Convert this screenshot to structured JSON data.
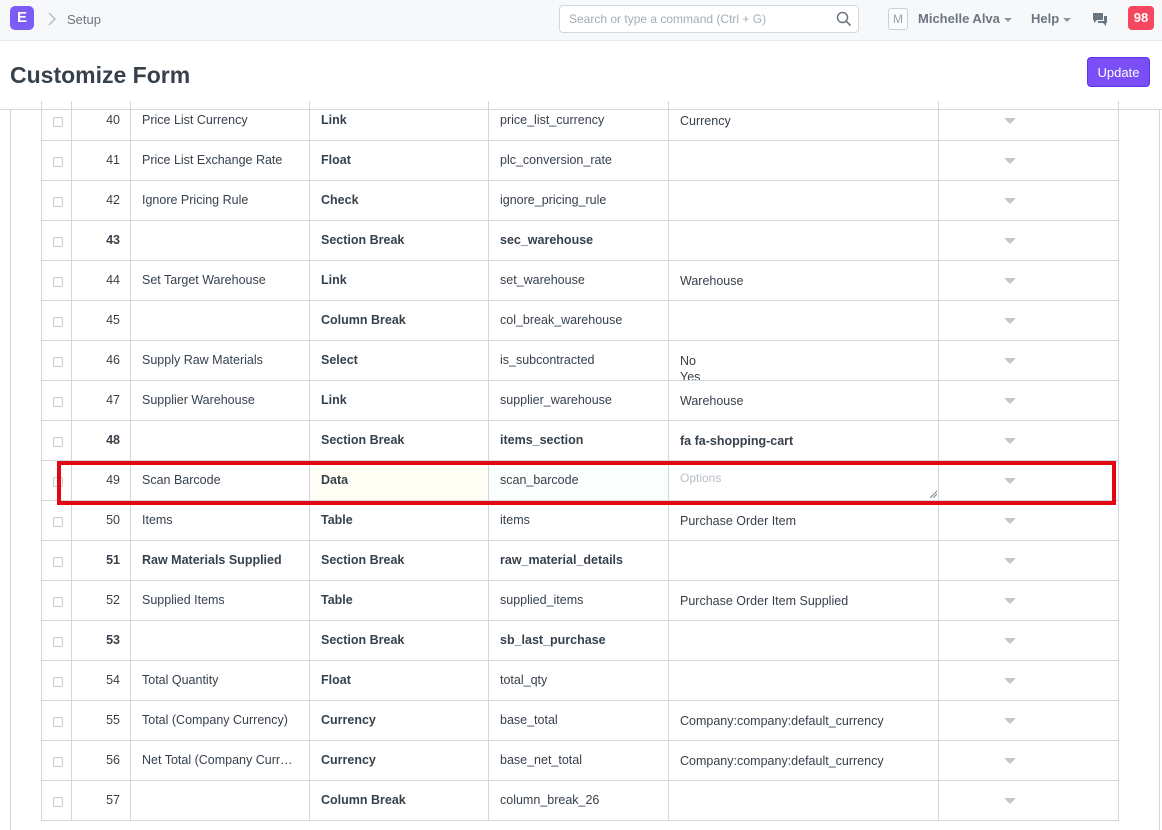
{
  "navbar": {
    "logo_letter": "E",
    "breadcrumb": "Setup",
    "search_placeholder": "Search or type a command (Ctrl + G)",
    "avatar_letter": "M",
    "user_name": "Michelle Alva",
    "help_label": "Help",
    "notification_count": "98"
  },
  "page": {
    "title": "Customize Form",
    "update_label": "Update"
  },
  "grid": {
    "options_placeholder": "Options",
    "rows": [
      {
        "idx": "40",
        "label": "Price List Currency",
        "type": "Link",
        "fieldname": "price_list_currency",
        "options": "Currency"
      },
      {
        "idx": "41",
        "label": "Price List Exchange Rate",
        "type": "Float",
        "fieldname": "plc_conversion_rate",
        "options": ""
      },
      {
        "idx": "42",
        "label": "Ignore Pricing Rule",
        "type": "Check",
        "fieldname": "ignore_pricing_rule",
        "options": ""
      },
      {
        "idx": "43",
        "label": "",
        "type": "Section Break",
        "fieldname": "sec_warehouse",
        "options": ""
      },
      {
        "idx": "44",
        "label": "Set Target Warehouse",
        "type": "Link",
        "fieldname": "set_warehouse",
        "options": "Warehouse"
      },
      {
        "idx": "45",
        "label": "",
        "type": "Column Break",
        "fieldname": "col_break_warehouse",
        "options": ""
      },
      {
        "idx": "46",
        "label": "Supply Raw Materials",
        "type": "Select",
        "fieldname": "is_subcontracted",
        "options": "No\nYes"
      },
      {
        "idx": "47",
        "label": "Supplier Warehouse",
        "type": "Link",
        "fieldname": "supplier_warehouse",
        "options": "Warehouse"
      },
      {
        "idx": "48",
        "label": "",
        "type": "Section Break",
        "fieldname": "items_section",
        "options": "fa fa-shopping-cart"
      },
      {
        "idx": "49",
        "label": "Scan Barcode",
        "type": "Data",
        "fieldname": "scan_barcode",
        "options": ""
      },
      {
        "idx": "50",
        "label": "Items",
        "type": "Table",
        "fieldname": "items",
        "options": "Purchase Order Item"
      },
      {
        "idx": "51",
        "label": "Raw Materials Supplied",
        "type": "Section Break",
        "fieldname": "raw_material_details",
        "options": ""
      },
      {
        "idx": "52",
        "label": "Supplied Items",
        "type": "Table",
        "fieldname": "supplied_items",
        "options": "Purchase Order Item Supplied"
      },
      {
        "idx": "53",
        "label": "",
        "type": "Section Break",
        "fieldname": "sb_last_purchase",
        "options": ""
      },
      {
        "idx": "54",
        "label": "Total Quantity",
        "type": "Float",
        "fieldname": "total_qty",
        "options": ""
      },
      {
        "idx": "55",
        "label": "Total (Company Currency)",
        "type": "Currency",
        "fieldname": "base_total",
        "options": "Company:company:default_currency"
      },
      {
        "idx": "56",
        "label": "Net Total (Company Currency)",
        "type": "Currency",
        "fieldname": "base_net_total",
        "options": "Company:company:default_currency"
      },
      {
        "idx": "57",
        "label": "",
        "type": "Column Break",
        "fieldname": "column_break_26",
        "options": ""
      }
    ]
  }
}
